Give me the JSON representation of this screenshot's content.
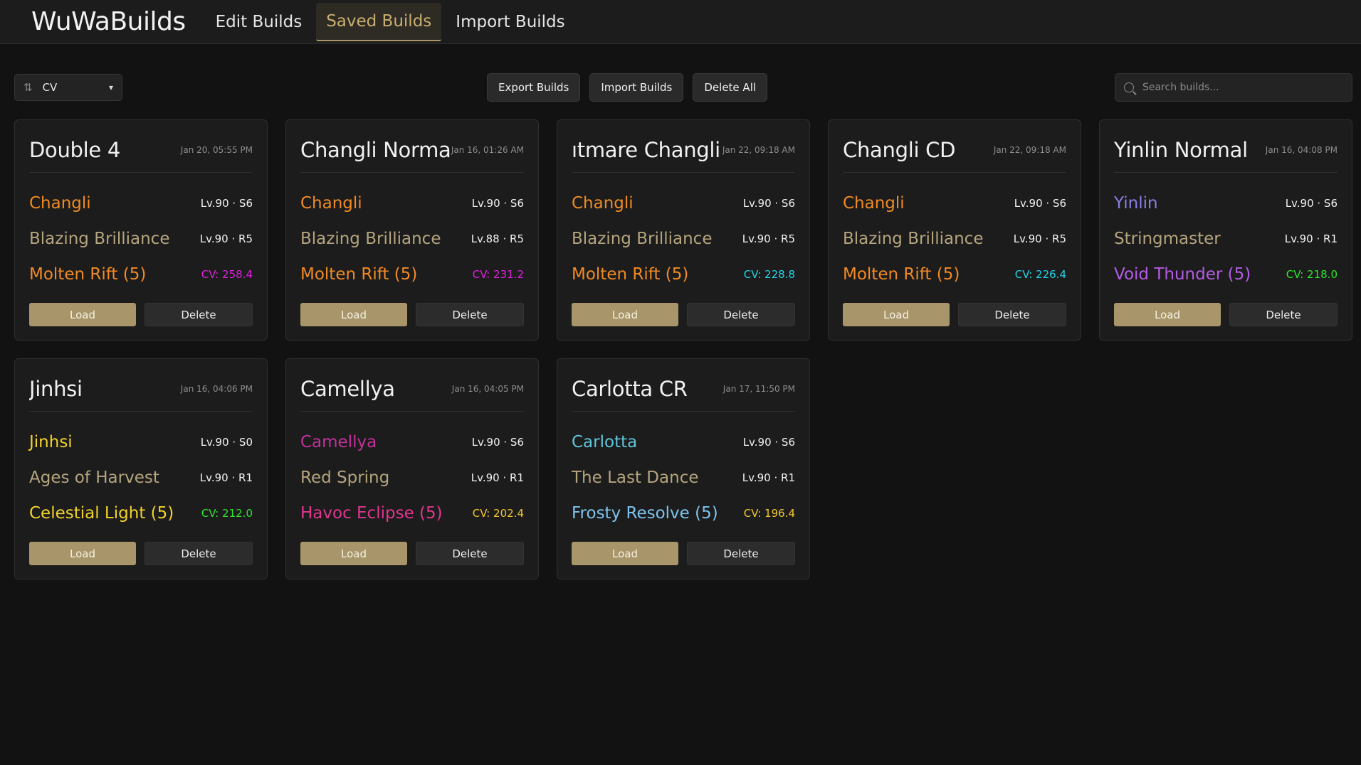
{
  "nav": {
    "brand": "WuWaBuilds",
    "tabs": [
      "Edit Builds",
      "Saved Builds",
      "Import Builds"
    ],
    "active_tab": "Saved Builds"
  },
  "toolbar": {
    "sort_value": "CV",
    "export_label": "Export Builds",
    "import_label": "Import Builds",
    "delete_all_label": "Delete All",
    "search_placeholder": "Search builds..."
  },
  "labels": {
    "load": "Load",
    "delete": "Delete"
  },
  "colors": {
    "accent": "#a8966a",
    "weapon": "#b5a57e",
    "changli": "#f08a24",
    "yinlin": "#8a7fe6",
    "jinhsi": "#f2d22a",
    "camellya": "#d4359a",
    "carlotta": "#5fc4d9"
  },
  "builds": [
    {
      "title": "Double 4",
      "date": "Jan 20, 05:55 PM",
      "title_clipped": false,
      "character": "Changli",
      "char_color": "#f08a24",
      "char_meta": "Lv.90 · S6",
      "weapon": "Blazing Brilliance",
      "weapon_meta": "Lv.90 · R5",
      "echo_set": "Molten Rift (5)",
      "echo_color": "#f08a24",
      "cv": "CV: 258.4",
      "cv_color": "#e11ee0"
    },
    {
      "title": "Changli Normal",
      "date": "Jan 16, 01:26 AM",
      "title_clipped": false,
      "character": "Changli",
      "char_color": "#f08a24",
      "char_meta": "Lv.90 · S6",
      "weapon": "Blazing Brilliance",
      "weapon_meta": "Lv.88 · R5",
      "echo_set": "Molten Rift (5)",
      "echo_color": "#f08a24",
      "cv": "CV: 231.2",
      "cv_color": "#e11ee0"
    },
    {
      "title": "ıtmare Changli",
      "date": "Jan 22, 09:18 AM",
      "title_clipped": true,
      "character": "Changli",
      "char_color": "#f08a24",
      "char_meta": "Lv.90 · S6",
      "weapon": "Blazing Brilliance",
      "weapon_meta": "Lv.90 · R5",
      "echo_set": "Molten Rift (5)",
      "echo_color": "#f08a24",
      "cv": "CV: 228.8",
      "cv_color": "#22d3e6"
    },
    {
      "title": "Changli CD",
      "date": "Jan 22, 09:18 AM",
      "title_clipped": false,
      "character": "Changli",
      "char_color": "#f08a24",
      "char_meta": "Lv.90 · S6",
      "weapon": "Blazing Brilliance",
      "weapon_meta": "Lv.90 · R5",
      "echo_set": "Molten Rift (5)",
      "echo_color": "#f08a24",
      "cv": "CV: 226.4",
      "cv_color": "#22d3e6"
    },
    {
      "title": "Yinlin Normal",
      "date": "Jan 16, 04:08 PM",
      "title_clipped": false,
      "character": "Yinlin",
      "char_color": "#8a7fe6",
      "char_meta": "Lv.90 · S6",
      "weapon": "Stringmaster",
      "weapon_meta": "Lv.90 · R1",
      "echo_set": "Void Thunder (5)",
      "echo_color": "#b45ce6",
      "cv": "CV: 218.0",
      "cv_color": "#2ee62e"
    },
    {
      "title": "Jinhsi",
      "date": "Jan 16, 04:06 PM",
      "title_clipped": false,
      "character": "Jinhsi",
      "char_color": "#f2d22a",
      "char_meta": "Lv.90 · S0",
      "weapon": "Ages of Harvest",
      "weapon_meta": "Lv.90 · R1",
      "echo_set": "Celestial Light (5)",
      "echo_color": "#f2d22a",
      "cv": "CV: 212.0",
      "cv_color": "#2ee62e"
    },
    {
      "title": "Camellya",
      "date": "Jan 16, 04:05 PM",
      "title_clipped": false,
      "character": "Camellya",
      "char_color": "#c2319a",
      "char_meta": "Lv.90 · S6",
      "weapon": "Red Spring",
      "weapon_meta": "Lv.90 · R1",
      "echo_set": "Havoc Eclipse (5)",
      "echo_color": "#e0358f",
      "cv": "CV: 202.4",
      "cv_color": "#f2c72a"
    },
    {
      "title": "Carlotta CR",
      "date": "Jan 17, 11:50 PM",
      "title_clipped": false,
      "character": "Carlotta",
      "char_color": "#5fc4d9",
      "char_meta": "Lv.90 · S6",
      "weapon": "The Last Dance",
      "weapon_meta": "Lv.90 · R1",
      "echo_set": "Frosty Resolve (5)",
      "echo_color": "#7cc4ef",
      "cv": "CV: 196.4",
      "cv_color": "#f2c72a"
    }
  ]
}
